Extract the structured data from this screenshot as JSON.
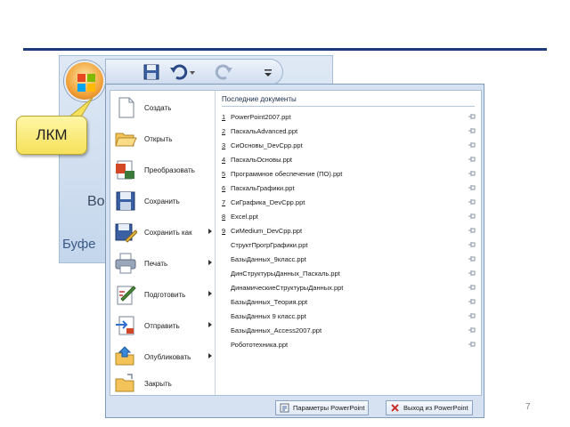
{
  "ribbon": {
    "behind_text": "Во",
    "group_label": "Буфе"
  },
  "callout": {
    "text": "ЛКМ"
  },
  "menu": {
    "commands": [
      {
        "label": "Создать",
        "icon": "new-document-icon",
        "has_submenu": false
      },
      {
        "label": "Открыть",
        "icon": "open-folder-icon",
        "has_submenu": false
      },
      {
        "label": "Преобразовать",
        "icon": "convert-icon",
        "has_submenu": false
      },
      {
        "label": "Сохранить",
        "icon": "save-icon",
        "has_submenu": false
      },
      {
        "label": "Сохранить как",
        "icon": "save-as-icon",
        "has_submenu": true
      },
      {
        "label": "Печать",
        "icon": "print-icon",
        "has_submenu": true
      },
      {
        "label": "Подготовить",
        "icon": "prepare-icon",
        "has_submenu": true
      },
      {
        "label": "Отправить",
        "icon": "send-icon",
        "has_submenu": true
      },
      {
        "label": "Опубликовать",
        "icon": "publish-icon",
        "has_submenu": true
      },
      {
        "label": "Закрыть",
        "icon": "close-folder-icon",
        "has_submenu": false
      }
    ],
    "recent_header": "Последние документы",
    "recent": [
      {
        "num": "1",
        "name": "PowerPoint2007.ppt"
      },
      {
        "num": "2",
        "name": "ПаскальAdvanced.ppt"
      },
      {
        "num": "3",
        "name": "СиОсновы_DevCpp.ppt"
      },
      {
        "num": "4",
        "name": "ПаскальОсновы.ppt"
      },
      {
        "num": "5",
        "name": "Программное обеспечение (ПО).ppt"
      },
      {
        "num": "6",
        "name": "ПаскальГрафики.ppt"
      },
      {
        "num": "7",
        "name": "СиГрафика_DevCpp.ppt"
      },
      {
        "num": "8",
        "name": "Excel.ppt"
      },
      {
        "num": "9",
        "name": "CиMedium_DevCpp.ppt"
      },
      {
        "num": "",
        "name": "СтруктПрогрГрафики.ppt"
      },
      {
        "num": "",
        "name": "БазыДанных_9класс.ppt"
      },
      {
        "num": "",
        "name": "ДинСтруктурыДанных_Паскаль.ppt"
      },
      {
        "num": "",
        "name": "ДинамическиеСтруктурыДанных.ppt"
      },
      {
        "num": "",
        "name": "БазыДанных_Теория.ppt"
      },
      {
        "num": "",
        "name": "БазыДанных 9 класс.ppt"
      },
      {
        "num": "",
        "name": "БазыДанных_Access2007.ppt"
      },
      {
        "num": "",
        "name": "Робототехника.ppt"
      }
    ],
    "options_label": "Параметры PowerPoint",
    "exit_label": "Выход из PowerPoint"
  },
  "slide_number": "7",
  "colors": {
    "accent": "#1f3a7a",
    "callout": "#f5e15a"
  }
}
